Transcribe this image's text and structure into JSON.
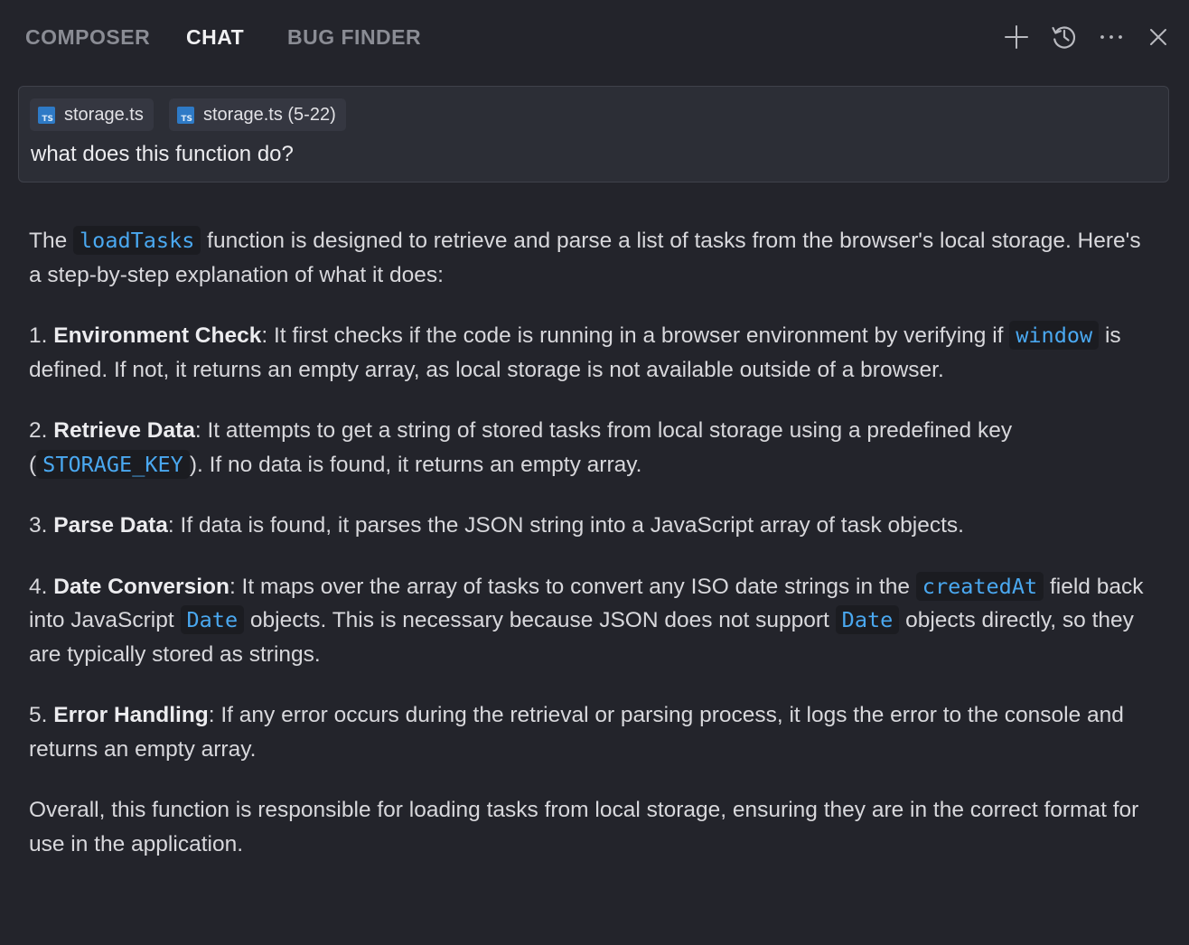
{
  "tabs": [
    {
      "label": "COMPOSER",
      "active": false
    },
    {
      "label": "CHAT",
      "active": true
    },
    {
      "label": "BUG FINDER",
      "active": false
    }
  ],
  "toolbar": {
    "icons": [
      "plus-icon",
      "history-icon",
      "more-icon",
      "close-icon"
    ]
  },
  "input": {
    "chips": [
      {
        "icon": "ts-file-icon",
        "icon_text": "TS",
        "label": "storage.ts"
      },
      {
        "icon": "ts-file-icon",
        "icon_text": "TS",
        "label": "storage.ts (5-22)"
      }
    ],
    "prompt": "what does this function do?"
  },
  "response": {
    "intro": {
      "pre": "The ",
      "code": "loadTasks",
      "post": " function is designed to retrieve and parse a list of tasks from the browser's local storage. Here's a step-by-step explanation of what it does:"
    },
    "steps": [
      {
        "num": "1. ",
        "title": "Environment Check",
        "t1": ": It first checks if the code is running in a browser environment by verifying if ",
        "c1": "window",
        "t2": " is defined. If not, it returns an empty array, as local storage is not available outside of a browser."
      },
      {
        "num": "2. ",
        "title": "Retrieve Data",
        "t1": ": It attempts to get a string of stored tasks from local storage using a predefined key (",
        "c1": "STORAGE_KEY",
        "t2": "). If no data is found, it returns an empty array."
      },
      {
        "num": "3. ",
        "title": "Parse Data",
        "t1": ": If data is found, it parses the JSON string into a JavaScript array of task objects."
      },
      {
        "num": "4. ",
        "title": "Date Conversion",
        "t1": ": It maps over the array of tasks to convert any ISO date strings in the ",
        "c1": "createdAt",
        "t2": " field back into JavaScript ",
        "c2": "Date",
        "t3": " objects. This is necessary because JSON does not support ",
        "c3": "Date",
        "t4": " objects directly, so they are typically stored as strings."
      },
      {
        "num": "5. ",
        "title": "Error Handling",
        "t1": ": If any error occurs during the retrieval or parsing process, it logs the error to the console and returns an empty array."
      }
    ],
    "summary": "Overall, this function is responsible for loading tasks from local storage, ensuring they are in the correct format for use in the application."
  },
  "colors": {
    "background": "#23242b",
    "input_bg": "#2c2e36",
    "code_text": "#4aa8f0",
    "ts_icon": "#2e7ac6"
  }
}
